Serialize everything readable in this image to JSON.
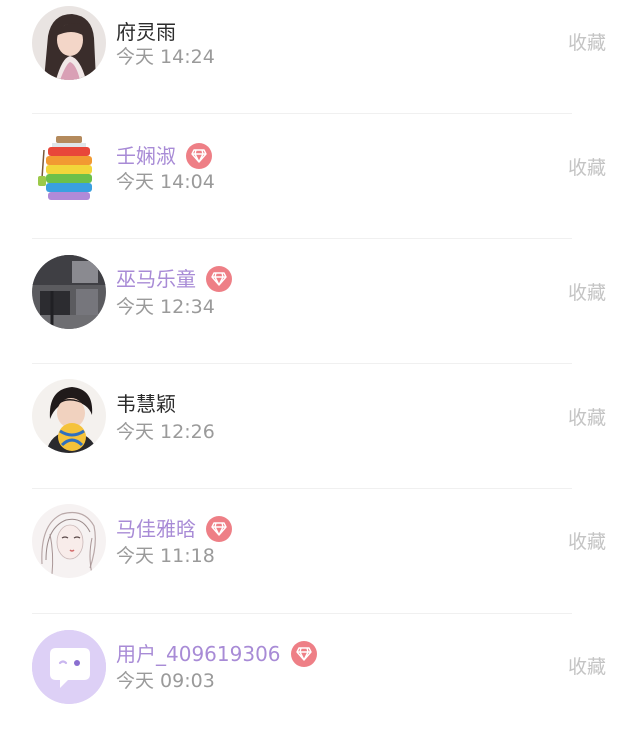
{
  "contacts": [
    {
      "name": "府灵雨",
      "time": "今天 14:24",
      "vip": false,
      "fav_label": "收藏",
      "avatar": "avatar-girl-long-hair"
    },
    {
      "name": "壬娴淑",
      "time": "今天 14:04",
      "vip": true,
      "fav_label": "收藏",
      "avatar": "avatar-rainbow-jar"
    },
    {
      "name": "巫马乐童",
      "time": "今天 12:34",
      "vip": true,
      "fav_label": "收藏",
      "avatar": "avatar-dark-room"
    },
    {
      "name": "韦慧颖",
      "time": "今天 12:26",
      "vip": false,
      "fav_label": "收藏",
      "avatar": "avatar-girl-volleyball"
    },
    {
      "name": "马佳雅晗",
      "time": "今天 11:18",
      "vip": true,
      "fav_label": "收藏",
      "avatar": "avatar-sketch-woman"
    },
    {
      "name": "用户_409619306",
      "time": "今天 09:03",
      "vip": true,
      "fav_label": "收藏",
      "avatar": "avatar-default-chat"
    }
  ],
  "colors": {
    "vip_name": "#a88bd6",
    "normal_name": "#2b2b2b",
    "vip_badge": "#ee7f86",
    "time": "#9a9a9a",
    "fav": "#c4c4c4",
    "default_avatar": "#ddd0f6"
  },
  "icons": {
    "vip": "diamond-icon"
  }
}
